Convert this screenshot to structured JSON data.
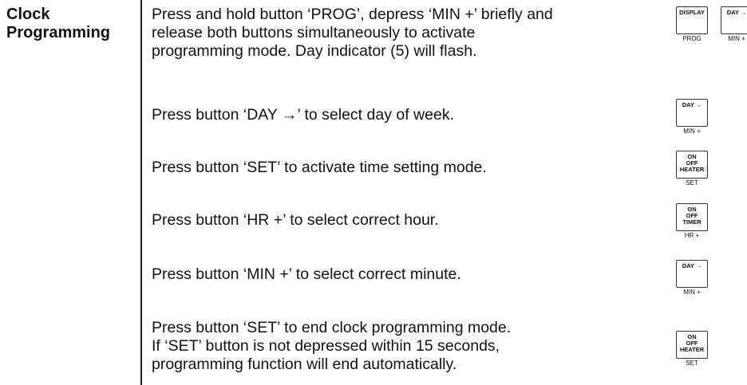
{
  "section": {
    "title_line1": "Clock",
    "title_line2": "Programming"
  },
  "steps": [
    {
      "lines": [
        "Press and hold button ‘PROG’, depress ‘MIN +’ briefly and",
        "release both buttons simultaneously to activate",
        "programming mode.  Day indicator (5) will flash."
      ]
    },
    {
      "lines": [
        "Press button ‘DAY →’ to select day of week."
      ]
    },
    {
      "lines": [
        "Press button ‘SET’ to activate time setting mode."
      ]
    },
    {
      "lines": [
        "Press button ‘HR +’ to select correct hour."
      ]
    },
    {
      "lines": [
        "Press button ‘MIN +’ to select correct minute."
      ]
    },
    {
      "lines": [
        "Press button ‘SET’ to end clock programming mode.",
        "If ‘SET’ button is not depressed within 15 seconds,",
        "programming function will end automatically."
      ]
    }
  ],
  "buttons": {
    "display": {
      "face": [
        "DISPLAY"
      ],
      "sub": "PROG"
    },
    "day_min_a": {
      "face": [
        "DAY →"
      ],
      "sub": "MIN +"
    },
    "day_min_b": {
      "face": [
        "DAY →"
      ],
      "sub": "MIN +"
    },
    "heater_a": {
      "face": [
        "ON",
        "OFF",
        "HEATER"
      ],
      "sub": "SET"
    },
    "timer": {
      "face": [
        "ON",
        "OFF",
        "TIMER"
      ],
      "sub": "HR +"
    },
    "day_min_c": {
      "face": [
        "DAY →"
      ],
      "sub": "MIN +"
    },
    "heater_b": {
      "face": [
        "ON",
        "OFF",
        "HEATER"
      ],
      "sub": "SET"
    }
  }
}
